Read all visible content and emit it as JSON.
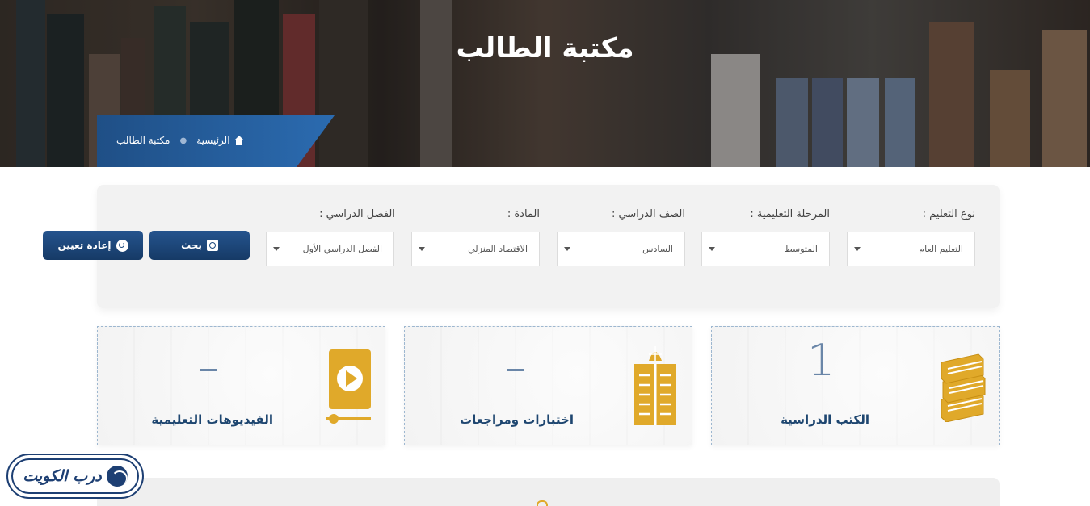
{
  "header": {
    "title": "مكتبة الطالب",
    "breadcrumb": {
      "home_label": "الرئيسية",
      "current_label": "مكتبة الطالب"
    }
  },
  "filters": {
    "education_type": {
      "label": "نوع التعليم :",
      "value": "التعليم العام"
    },
    "stage": {
      "label": "المرحلة التعليمية :",
      "value": "المتوسط"
    },
    "grade": {
      "label": "الصف الدراسي :",
      "value": "السادس"
    },
    "subject": {
      "label": "المادة :",
      "value": "الاقتصاد المنزلي"
    },
    "semester": {
      "label": "الفصل الدراسي :",
      "value": "الفصل الدراسي الأول"
    },
    "search_label": "بحث",
    "reset_label": "إعادة تعيين"
  },
  "cards": [
    {
      "title": "الكتب الدراسية",
      "count": "1",
      "icon": "books-icon"
    },
    {
      "title": "اختبارات ومراجعات",
      "count": "-",
      "icon": "exam-book-icon"
    },
    {
      "title": "الفيديوهات التعليمية",
      "count": "-",
      "icon": "video-player-icon"
    }
  ],
  "logo": {
    "text": "درب الكويت"
  },
  "colors": {
    "primary": "#1e4a7e",
    "accent": "#e0a92a",
    "number": "#6a86a8"
  }
}
